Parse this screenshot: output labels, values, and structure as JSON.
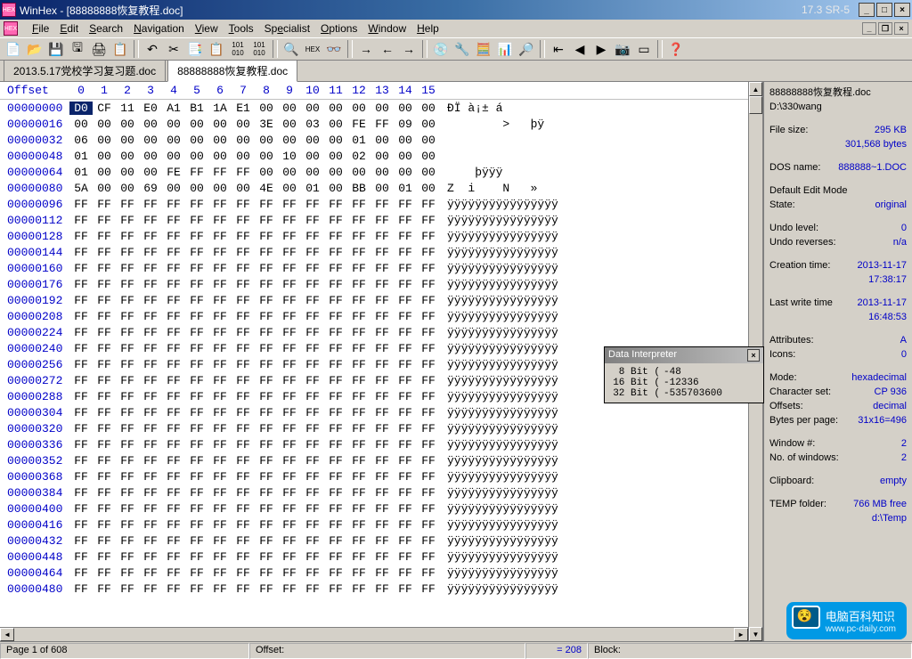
{
  "title": "WinHex - [88888888恢复教程.doc]",
  "version": "17.3 SR-5",
  "menu": [
    "File",
    "Edit",
    "Search",
    "Navigation",
    "View",
    "Tools",
    "Specialist",
    "Options",
    "Window",
    "Help"
  ],
  "tabs": [
    {
      "label": "2013.5.17党校学习复习题.doc",
      "active": false
    },
    {
      "label": "88888888恢复教程.doc",
      "active": true
    }
  ],
  "hex": {
    "offset_label": "Offset",
    "cols": [
      "0",
      "1",
      "2",
      "3",
      "4",
      "5",
      "6",
      "7",
      "8",
      "9",
      "10",
      "11",
      "12",
      "13",
      "14",
      "15"
    ],
    "rows": [
      {
        "off": "00000000",
        "b": [
          "D0",
          "CF",
          "11",
          "E0",
          "A1",
          "B1",
          "1A",
          "E1",
          "00",
          "00",
          "00",
          "00",
          "00",
          "00",
          "00",
          "00"
        ],
        "a": "ÐÏ à¡± á        "
      },
      {
        "off": "00000016",
        "b": [
          "00",
          "00",
          "00",
          "00",
          "00",
          "00",
          "00",
          "00",
          "3E",
          "00",
          "03",
          "00",
          "FE",
          "FF",
          "09",
          "00"
        ],
        "a": "        >   þÿ  "
      },
      {
        "off": "00000032",
        "b": [
          "06",
          "00",
          "00",
          "00",
          "00",
          "00",
          "00",
          "00",
          "00",
          "00",
          "00",
          "00",
          "01",
          "00",
          "00",
          "00"
        ],
        "a": "                "
      },
      {
        "off": "00000048",
        "b": [
          "01",
          "00",
          "00",
          "00",
          "00",
          "00",
          "00",
          "00",
          "00",
          "10",
          "00",
          "00",
          "02",
          "00",
          "00",
          "00"
        ],
        "a": "                "
      },
      {
        "off": "00000064",
        "b": [
          "01",
          "00",
          "00",
          "00",
          "FE",
          "FF",
          "FF",
          "FF",
          "00",
          "00",
          "00",
          "00",
          "00",
          "00",
          "00",
          "00"
        ],
        "a": "    þÿÿÿ        "
      },
      {
        "off": "00000080",
        "b": [
          "5A",
          "00",
          "00",
          "69",
          "00",
          "00",
          "00",
          "00",
          "4E",
          "00",
          "01",
          "00",
          "BB",
          "00",
          "01",
          "00"
        ],
        "a": "Z  i    N   »   "
      },
      {
        "off": "00000096",
        "b": [
          "FF",
          "FF",
          "FF",
          "FF",
          "FF",
          "FF",
          "FF",
          "FF",
          "FF",
          "FF",
          "FF",
          "FF",
          "FF",
          "FF",
          "FF",
          "FF"
        ],
        "a": "ÿÿÿÿÿÿÿÿÿÿÿÿÿÿÿÿ"
      },
      {
        "off": "00000112",
        "b": [
          "FF",
          "FF",
          "FF",
          "FF",
          "FF",
          "FF",
          "FF",
          "FF",
          "FF",
          "FF",
          "FF",
          "FF",
          "FF",
          "FF",
          "FF",
          "FF"
        ],
        "a": "ÿÿÿÿÿÿÿÿÿÿÿÿÿÿÿÿ"
      },
      {
        "off": "00000128",
        "b": [
          "FF",
          "FF",
          "FF",
          "FF",
          "FF",
          "FF",
          "FF",
          "FF",
          "FF",
          "FF",
          "FF",
          "FF",
          "FF",
          "FF",
          "FF",
          "FF"
        ],
        "a": "ÿÿÿÿÿÿÿÿÿÿÿÿÿÿÿÿ"
      },
      {
        "off": "00000144",
        "b": [
          "FF",
          "FF",
          "FF",
          "FF",
          "FF",
          "FF",
          "FF",
          "FF",
          "FF",
          "FF",
          "FF",
          "FF",
          "FF",
          "FF",
          "FF",
          "FF"
        ],
        "a": "ÿÿÿÿÿÿÿÿÿÿÿÿÿÿÿÿ"
      },
      {
        "off": "00000160",
        "b": [
          "FF",
          "FF",
          "FF",
          "FF",
          "FF",
          "FF",
          "FF",
          "FF",
          "FF",
          "FF",
          "FF",
          "FF",
          "FF",
          "FF",
          "FF",
          "FF"
        ],
        "a": "ÿÿÿÿÿÿÿÿÿÿÿÿÿÿÿÿ"
      },
      {
        "off": "00000176",
        "b": [
          "FF",
          "FF",
          "FF",
          "FF",
          "FF",
          "FF",
          "FF",
          "FF",
          "FF",
          "FF",
          "FF",
          "FF",
          "FF",
          "FF",
          "FF",
          "FF"
        ],
        "a": "ÿÿÿÿÿÿÿÿÿÿÿÿÿÿÿÿ"
      },
      {
        "off": "00000192",
        "b": [
          "FF",
          "FF",
          "FF",
          "FF",
          "FF",
          "FF",
          "FF",
          "FF",
          "FF",
          "FF",
          "FF",
          "FF",
          "FF",
          "FF",
          "FF",
          "FF"
        ],
        "a": "ÿÿÿÿÿÿÿÿÿÿÿÿÿÿÿÿ"
      },
      {
        "off": "00000208",
        "b": [
          "FF",
          "FF",
          "FF",
          "FF",
          "FF",
          "FF",
          "FF",
          "FF",
          "FF",
          "FF",
          "FF",
          "FF",
          "FF",
          "FF",
          "FF",
          "FF"
        ],
        "a": "ÿÿÿÿÿÿÿÿÿÿÿÿÿÿÿÿ"
      },
      {
        "off": "00000224",
        "b": [
          "FF",
          "FF",
          "FF",
          "FF",
          "FF",
          "FF",
          "FF",
          "FF",
          "FF",
          "FF",
          "FF",
          "FF",
          "FF",
          "FF",
          "FF",
          "FF"
        ],
        "a": "ÿÿÿÿÿÿÿÿÿÿÿÿÿÿÿÿ"
      },
      {
        "off": "00000240",
        "b": [
          "FF",
          "FF",
          "FF",
          "FF",
          "FF",
          "FF",
          "FF",
          "FF",
          "FF",
          "FF",
          "FF",
          "FF",
          "FF",
          "FF",
          "FF",
          "FF"
        ],
        "a": "ÿÿÿÿÿÿÿÿÿÿÿÿÿÿÿÿ"
      },
      {
        "off": "00000256",
        "b": [
          "FF",
          "FF",
          "FF",
          "FF",
          "FF",
          "FF",
          "FF",
          "FF",
          "FF",
          "FF",
          "FF",
          "FF",
          "FF",
          "FF",
          "FF",
          "FF"
        ],
        "a": "ÿÿÿÿÿÿÿÿÿÿÿÿÿÿÿÿ"
      },
      {
        "off": "00000272",
        "b": [
          "FF",
          "FF",
          "FF",
          "FF",
          "FF",
          "FF",
          "FF",
          "FF",
          "FF",
          "FF",
          "FF",
          "FF",
          "FF",
          "FF",
          "FF",
          "FF"
        ],
        "a": "ÿÿÿÿÿÿÿÿÿÿÿÿÿÿÿÿ"
      },
      {
        "off": "00000288",
        "b": [
          "FF",
          "FF",
          "FF",
          "FF",
          "FF",
          "FF",
          "FF",
          "FF",
          "FF",
          "FF",
          "FF",
          "FF",
          "FF",
          "FF",
          "FF",
          "FF"
        ],
        "a": "ÿÿÿÿÿÿÿÿÿÿÿÿÿÿÿÿ"
      },
      {
        "off": "00000304",
        "b": [
          "FF",
          "FF",
          "FF",
          "FF",
          "FF",
          "FF",
          "FF",
          "FF",
          "FF",
          "FF",
          "FF",
          "FF",
          "FF",
          "FF",
          "FF",
          "FF"
        ],
        "a": "ÿÿÿÿÿÿÿÿÿÿÿÿÿÿÿÿ"
      },
      {
        "off": "00000320",
        "b": [
          "FF",
          "FF",
          "FF",
          "FF",
          "FF",
          "FF",
          "FF",
          "FF",
          "FF",
          "FF",
          "FF",
          "FF",
          "FF",
          "FF",
          "FF",
          "FF"
        ],
        "a": "ÿÿÿÿÿÿÿÿÿÿÿÿÿÿÿÿ"
      },
      {
        "off": "00000336",
        "b": [
          "FF",
          "FF",
          "FF",
          "FF",
          "FF",
          "FF",
          "FF",
          "FF",
          "FF",
          "FF",
          "FF",
          "FF",
          "FF",
          "FF",
          "FF",
          "FF"
        ],
        "a": "ÿÿÿÿÿÿÿÿÿÿÿÿÿÿÿÿ"
      },
      {
        "off": "00000352",
        "b": [
          "FF",
          "FF",
          "FF",
          "FF",
          "FF",
          "FF",
          "FF",
          "FF",
          "FF",
          "FF",
          "FF",
          "FF",
          "FF",
          "FF",
          "FF",
          "FF"
        ],
        "a": "ÿÿÿÿÿÿÿÿÿÿÿÿÿÿÿÿ"
      },
      {
        "off": "00000368",
        "b": [
          "FF",
          "FF",
          "FF",
          "FF",
          "FF",
          "FF",
          "FF",
          "FF",
          "FF",
          "FF",
          "FF",
          "FF",
          "FF",
          "FF",
          "FF",
          "FF"
        ],
        "a": "ÿÿÿÿÿÿÿÿÿÿÿÿÿÿÿÿ"
      },
      {
        "off": "00000384",
        "b": [
          "FF",
          "FF",
          "FF",
          "FF",
          "FF",
          "FF",
          "FF",
          "FF",
          "FF",
          "FF",
          "FF",
          "FF",
          "FF",
          "FF",
          "FF",
          "FF"
        ],
        "a": "ÿÿÿÿÿÿÿÿÿÿÿÿÿÿÿÿ"
      },
      {
        "off": "00000400",
        "b": [
          "FF",
          "FF",
          "FF",
          "FF",
          "FF",
          "FF",
          "FF",
          "FF",
          "FF",
          "FF",
          "FF",
          "FF",
          "FF",
          "FF",
          "FF",
          "FF"
        ],
        "a": "ÿÿÿÿÿÿÿÿÿÿÿÿÿÿÿÿ"
      },
      {
        "off": "00000416",
        "b": [
          "FF",
          "FF",
          "FF",
          "FF",
          "FF",
          "FF",
          "FF",
          "FF",
          "FF",
          "FF",
          "FF",
          "FF",
          "FF",
          "FF",
          "FF",
          "FF"
        ],
        "a": "ÿÿÿÿÿÿÿÿÿÿÿÿÿÿÿÿ"
      },
      {
        "off": "00000432",
        "b": [
          "FF",
          "FF",
          "FF",
          "FF",
          "FF",
          "FF",
          "FF",
          "FF",
          "FF",
          "FF",
          "FF",
          "FF",
          "FF",
          "FF",
          "FF",
          "FF"
        ],
        "a": "ÿÿÿÿÿÿÿÿÿÿÿÿÿÿÿÿ"
      },
      {
        "off": "00000448",
        "b": [
          "FF",
          "FF",
          "FF",
          "FF",
          "FF",
          "FF",
          "FF",
          "FF",
          "FF",
          "FF",
          "FF",
          "FF",
          "FF",
          "FF",
          "FF",
          "FF"
        ],
        "a": "ÿÿÿÿÿÿÿÿÿÿÿÿÿÿÿÿ"
      },
      {
        "off": "00000464",
        "b": [
          "FF",
          "FF",
          "FF",
          "FF",
          "FF",
          "FF",
          "FF",
          "FF",
          "FF",
          "FF",
          "FF",
          "FF",
          "FF",
          "FF",
          "FF",
          "FF"
        ],
        "a": "ÿÿÿÿÿÿÿÿÿÿÿÿÿÿÿÿ"
      },
      {
        "off": "00000480",
        "b": [
          "FF",
          "FF",
          "FF",
          "FF",
          "FF",
          "FF",
          "FF",
          "FF",
          "FF",
          "FF",
          "FF",
          "FF",
          "FF",
          "FF",
          "FF",
          "FF"
        ],
        "a": "ÿÿÿÿÿÿÿÿÿÿÿÿÿÿÿÿ"
      }
    ]
  },
  "info": {
    "filename": "88888888恢复教程.doc",
    "path": "D:\\330wang",
    "filesize_label": "File size:",
    "filesize": "295 KB",
    "filesize_bytes": "301,568 bytes",
    "dosname_label": "DOS name:",
    "dosname": "888888~1.DOC",
    "editmode_label": "Default Edit Mode",
    "state_label": "State:",
    "state": "original",
    "undolevel_label": "Undo level:",
    "undolevel": "0",
    "undorev_label": "Undo reverses:",
    "undorev": "n/a",
    "ctime_label": "Creation time:",
    "ctime": "2013-11-17",
    "ctime2": "17:38:17",
    "wtime_label": "Last write time",
    "wtime": "2013-11-17",
    "wtime2": "16:48:53",
    "attr_label": "Attributes:",
    "attr": "A",
    "icons_label": "Icons:",
    "icons": "0",
    "mode_label": "Mode:",
    "mode": "hexadecimal",
    "charset_label": "Character set:",
    "charset": "CP 936",
    "offsets_label": "Offsets:",
    "offsets": "decimal",
    "bpp_label": "Bytes per page:",
    "bpp": "31x16=496",
    "winn_label": "Window #:",
    "winn": "2",
    "nwin_label": "No. of windows:",
    "nwin": "2",
    "clip_label": "Clipboard:",
    "clip": "empty",
    "temp_label": "TEMP folder:",
    "temp": "766 MB free",
    "temp2": "d:\\Temp"
  },
  "interpreter": {
    "title": "Data Interpreter",
    "r8_label": "8 Bit (",
    "r8": "-48",
    "r16_label": "16 Bit (",
    "r16": "-12336",
    "r32_label": "32 Bit (",
    "r32": "-535703600"
  },
  "status": {
    "page": "Page 1 of 608",
    "offset_label": "Offset:",
    "cursor": "= 208",
    "block_label": "Block:"
  },
  "watermark": {
    "title": "电脑百科知识",
    "url": "www.pc-daily.com"
  }
}
